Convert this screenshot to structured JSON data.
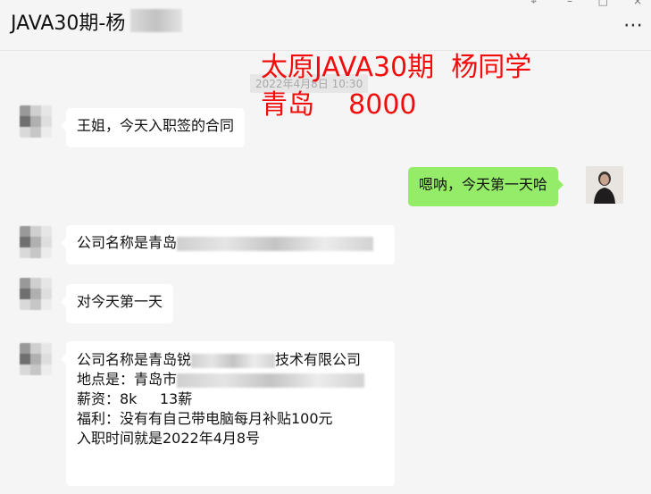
{
  "window": {
    "title_visible": "JAVA30期-杨",
    "more_icon": "ellipsis-icon"
  },
  "overlay": {
    "line1": "太原JAVA30期  杨同学",
    "line2": "青岛    8000"
  },
  "timestamp": "2022年4月8日 10:30",
  "messages": {
    "m1": "王姐，今天入职签的合同",
    "m2": "嗯呐，今天第一天哈",
    "m3_prefix": "公司名称是青岛",
    "m4": "对今天第一天",
    "m5": {
      "line1_prefix": "公司名称是青岛锐",
      "line1_suffix": "技术有限公司",
      "line2_prefix": "地点是：青岛市",
      "line3": "薪资：8k     13薪",
      "line4": "福利：没有有自己带电脑每月补贴100元",
      "line5": "入职时间就是2022年4月8号"
    }
  },
  "colors": {
    "self_bubble": "#95ec69",
    "other_bubble": "#ffffff",
    "overlay_text": "#f20c0c",
    "background": "#f5f5f5"
  }
}
